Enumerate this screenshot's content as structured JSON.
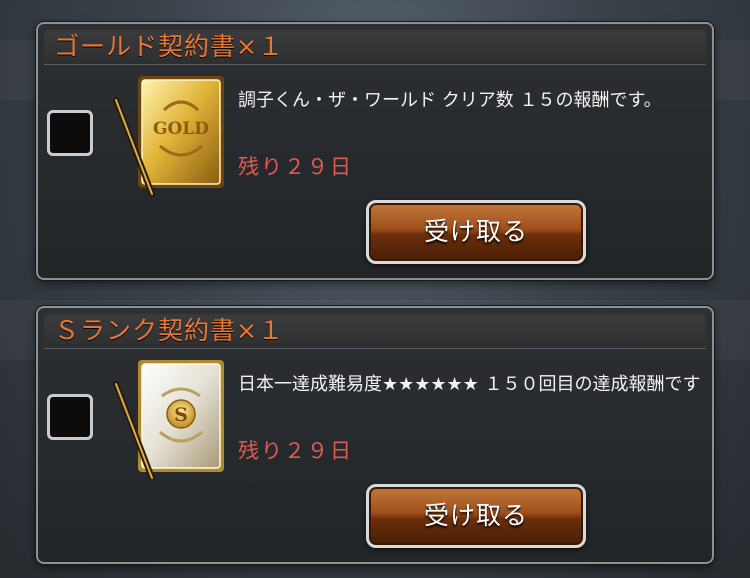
{
  "rewards": [
    {
      "title": "ゴールド契約書×１",
      "item_icon": "gold-contract-icon",
      "description": "調子くん・ザ・ワールド クリア数 １５の報酬です。",
      "remaining": "残り２９日",
      "button_label": "受け取る"
    },
    {
      "title": "Ｓランク契約書×１",
      "item_icon": "s-rank-contract-icon",
      "description": "日本一達成難易度★★★★★★ １５０回目の達成報酬です",
      "remaining": "残り２９日",
      "button_label": "受け取る"
    }
  ],
  "colors": {
    "title": "#e87634",
    "remaining": "#e05a52",
    "button": "#9e4f1c"
  }
}
